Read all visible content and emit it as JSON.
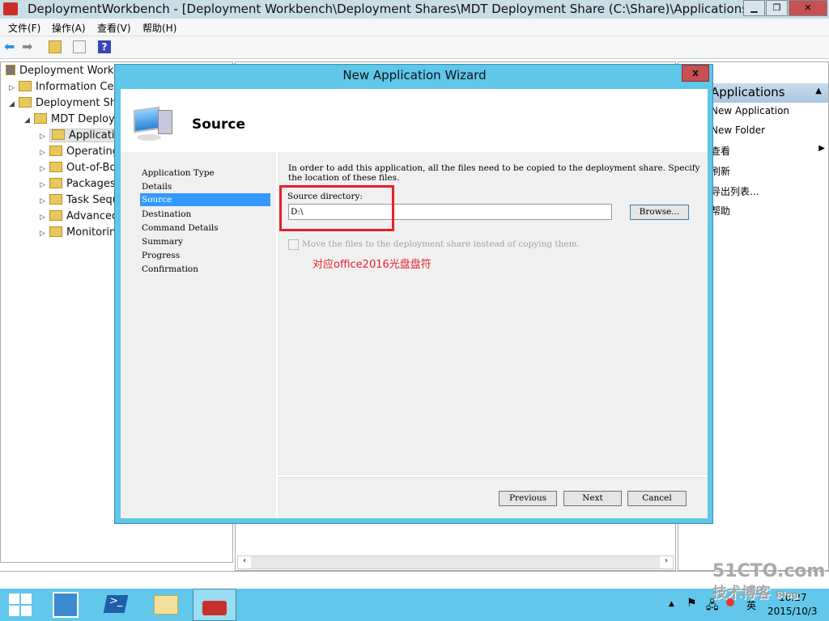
{
  "window": {
    "title": "DeploymentWorkbench - [Deployment Workbench\\Deployment Shares\\MDT Deployment Share (C:\\Share)\\Applications]",
    "minimize": "▁",
    "restore": "❐",
    "close": "✕"
  },
  "menu": [
    "文件(F)",
    "操作(A)",
    "查看(V)",
    "帮助(H)"
  ],
  "toolbar": {
    "icons": [
      "back-icon",
      "forward-icon",
      "up-folder-icon",
      "export-list-icon",
      "help-icon"
    ],
    "help_label": "?"
  },
  "tree": [
    {
      "label": "Deployment Workbench",
      "arrow": ""
    },
    {
      "label": "Information Center",
      "arrow": "▷"
    },
    {
      "label": "Deployment Shares",
      "arrow": "◢"
    },
    {
      "label": "MDT Deployment Share",
      "arrow": "◢"
    },
    {
      "label": "Applications",
      "arrow": "▷"
    },
    {
      "label": "Operating Systems",
      "arrow": "▷"
    },
    {
      "label": "Out-of-Box Drivers",
      "arrow": "▷"
    },
    {
      "label": "Packages",
      "arrow": "▷"
    },
    {
      "label": "Task Sequences",
      "arrow": "▷"
    },
    {
      "label": "Advanced Configuration",
      "arrow": "▷"
    },
    {
      "label": "Monitoring",
      "arrow": "▷"
    }
  ],
  "actions": {
    "header": "Applications",
    "items": [
      "New Application",
      "New Folder",
      "查看",
      "刷新",
      "导出列表...",
      "帮助"
    ]
  },
  "wizard": {
    "title": "New Application Wizard",
    "page_title": "Source",
    "steps": [
      "Application Type",
      "Details",
      "Source",
      "Destination",
      "Command Details",
      "Summary",
      "Progress",
      "Confirmation"
    ],
    "selected_step": "Source",
    "description": "In order to add this application, all the files need to be copied to the deployment share.  Specify the location of these files.",
    "source_label": "Source directory:",
    "source_value": "D:\\",
    "browse": "Browse...",
    "move_checkbox": {
      "label": "Move the files to the deployment share instead of copying them.",
      "checked": false,
      "enabled": false
    },
    "annotation": "对应office2016光盘盘符",
    "previous": "Previous",
    "next": "Next",
    "cancel": "Cancel"
  },
  "taskbar": {
    "time": "16:27",
    "date": "2015/10/3",
    "ime": "英"
  },
  "watermark": "51CTO.com 技术博客 Blog",
  "colors": {
    "accent": "#3399ff",
    "dialog_frame": "#5ec7ea",
    "annotation": "#e8202a",
    "taskbar": "#62c7ea"
  }
}
